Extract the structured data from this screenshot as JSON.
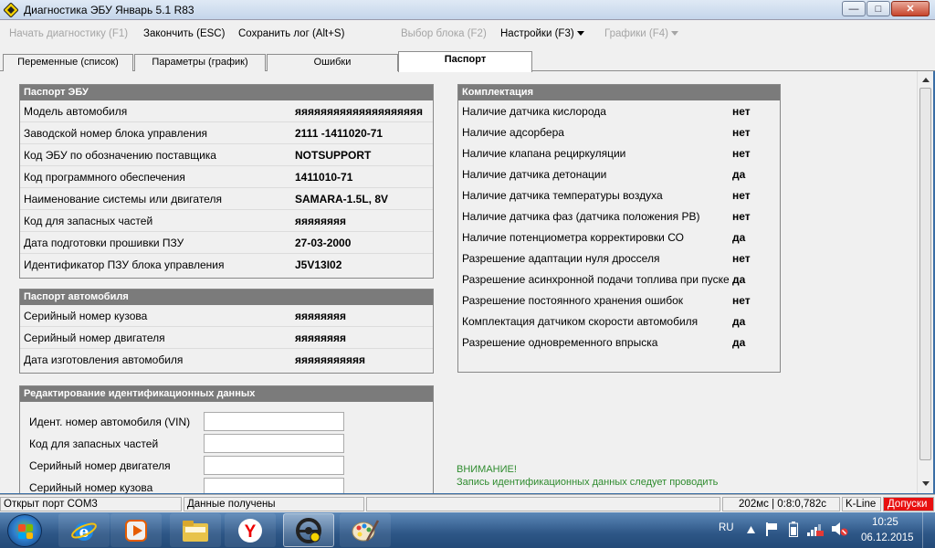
{
  "window": {
    "title": "Диагностика ЭБУ Январь 5.1 R83",
    "controls": {
      "minimize": "—",
      "maximize": "□",
      "close": "✕"
    }
  },
  "menu": {
    "start_diag": "Начать диагностику (F1)",
    "finish": "Закончить (ESC)",
    "save_log": "Сохранить лог (Alt+S)",
    "select_block": "Выбор блока (F2)",
    "settings": "Настройки (F3)",
    "graphs": "Графики (F4)"
  },
  "tabs": [
    {
      "label": "Переменные (список)"
    },
    {
      "label": "Параметры (график)"
    },
    {
      "label": "Ошибки"
    },
    {
      "label": "Паспорт"
    }
  ],
  "ecu_passport": {
    "header": "Паспорт ЭБУ",
    "rows": [
      {
        "label": "Модель автомобиля",
        "value": "яяяяяяяяяяяяяяяяяяяя"
      },
      {
        "label": "Заводской номер блока управления",
        "value": "2111 -1411020-71"
      },
      {
        "label": "Код ЭБУ по обозначению поставщика",
        "value": "NOTSUPPORT"
      },
      {
        "label": "Код программного обеспечения",
        "value": "1411010-71"
      },
      {
        "label": "Наименование системы или двигателя",
        "value": "SAMARA-1.5L, 8V"
      },
      {
        "label": "Код для запасных частей",
        "value": "яяяяяяяя"
      },
      {
        "label": "Дата подготовки прошивки ПЗУ",
        "value": "27-03-2000"
      },
      {
        "label": "Идентификатор ПЗУ блока управления",
        "value": "J5V13I02"
      }
    ]
  },
  "car_passport": {
    "header": "Паспорт автомобиля",
    "rows": [
      {
        "label": "Серийный номер кузова",
        "value": "яяяяяяяя"
      },
      {
        "label": "Серийный номер двигателя",
        "value": "яяяяяяяя"
      },
      {
        "label": "Дата изготовления автомобиля",
        "value": "яяяяяяяяяяя"
      }
    ]
  },
  "edit_ids": {
    "header": "Редактирование идентификационных данных",
    "fields": [
      {
        "label": "Идент. номер автомобиля (VIN)",
        "value": ""
      },
      {
        "label": "Код для запасных частей",
        "value": ""
      },
      {
        "label": "Серийный номер двигателя",
        "value": ""
      },
      {
        "label": "Серийный номер кузова",
        "value": ""
      }
    ]
  },
  "configuration": {
    "header": "Комплектация",
    "rows": [
      {
        "label": "Наличие датчика кислорода",
        "value": "нет"
      },
      {
        "label": "Наличие адсорбера",
        "value": "нет"
      },
      {
        "label": "Наличие клапана рециркуляции",
        "value": "нет"
      },
      {
        "label": "Наличие датчика детонации",
        "value": "да"
      },
      {
        "label": "Наличие датчика температуры воздуха",
        "value": "нет"
      },
      {
        "label": "Наличие датчика фаз (датчика положения РВ)",
        "value": "нет"
      },
      {
        "label": "Наличие потенциометра корректировки СО",
        "value": "да"
      },
      {
        "label": "Разрешение адаптации нуля дросселя",
        "value": "нет"
      },
      {
        "label": "Разрешение асинхронной подачи топлива при пуске",
        "value": "да"
      },
      {
        "label": "Разрешение постоянного хранения ошибок",
        "value": "нет"
      },
      {
        "label": "Комплектация датчиком скорости автомобиля",
        "value": "да"
      },
      {
        "label": "Разрешение одновременного впрыска",
        "value": "да"
      }
    ]
  },
  "warning": {
    "title": "ВНИМАНИЕ!",
    "text": "Запись идентификационных данных следует проводить"
  },
  "status": {
    "port": "Открыт порт COM3",
    "data": "Данные получены",
    "timing": "202мс | 0:8:0,782с",
    "line": "K-Line",
    "tolerance": "Допуски"
  },
  "taskbar": {
    "lang": "RU",
    "time": "10:25",
    "date": "06.12.2015"
  },
  "colors": {
    "panel_header": "#7b7b7b",
    "warning_text": "#2e8b2e",
    "status_danger": "#e81010"
  }
}
